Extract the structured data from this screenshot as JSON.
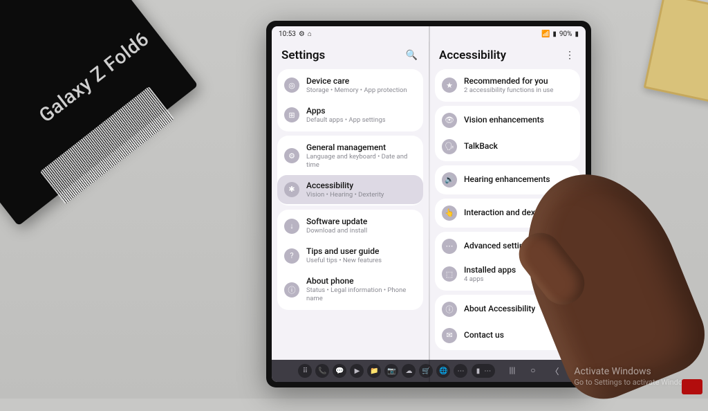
{
  "background": {
    "box_label": "Galaxy Z Fold6",
    "watermark_title": "Activate Windows",
    "watermark_sub": "Go to Settings to activate Windows."
  },
  "status": {
    "time": "10:53",
    "battery": "90%"
  },
  "left": {
    "title": "Settings",
    "groups": [
      {
        "items": [
          {
            "icon": "◎",
            "name": "device-care",
            "title": "Device care",
            "sub": "Storage • Memory • App protection"
          },
          {
            "icon": "⊞",
            "name": "apps",
            "title": "Apps",
            "sub": "Default apps • App settings"
          }
        ]
      },
      {
        "items": [
          {
            "icon": "⚙",
            "name": "general-management",
            "title": "General management",
            "sub": "Language and keyboard • Date and time"
          },
          {
            "icon": "✱",
            "name": "accessibility",
            "title": "Accessibility",
            "sub": "Vision • Hearing • Dexterity",
            "selected": true
          }
        ]
      },
      {
        "items": [
          {
            "icon": "↓",
            "name": "software-update",
            "title": "Software update",
            "sub": "Download and install"
          },
          {
            "icon": "?",
            "name": "tips",
            "title": "Tips and user guide",
            "sub": "Useful tips • New features"
          },
          {
            "icon": "ⓘ",
            "name": "about-phone",
            "title": "About phone",
            "sub": "Status • Legal information • Phone name"
          }
        ]
      }
    ]
  },
  "right": {
    "title": "Accessibility",
    "groups": [
      {
        "items": [
          {
            "icon": "★",
            "name": "recommended",
            "title": "Recommended for you",
            "sub": "2 accessibility functions in use"
          }
        ]
      },
      {
        "items": [
          {
            "icon": "👁",
            "name": "vision",
            "title": "Vision enhancements"
          },
          {
            "icon": "🗣",
            "name": "talkback",
            "title": "TalkBack"
          }
        ]
      },
      {
        "items": [
          {
            "icon": "🔊",
            "name": "hearing",
            "title": "Hearing enhancements"
          }
        ]
      },
      {
        "items": [
          {
            "icon": "👆",
            "name": "interaction",
            "title": "Interaction and dexterity"
          }
        ]
      },
      {
        "items": [
          {
            "icon": "⋯",
            "name": "advanced",
            "title": "Advanced settings"
          },
          {
            "icon": "⬚",
            "name": "installed",
            "title": "Installed apps",
            "sub": "4 apps"
          }
        ]
      },
      {
        "items": [
          {
            "icon": "ⓘ",
            "name": "about-accessibility",
            "title": "About Accessibility"
          },
          {
            "icon": "✉",
            "name": "contact",
            "title": "Contact us"
          }
        ]
      }
    ]
  },
  "taskbar": {
    "icons": [
      "⠿",
      "📞",
      "💬",
      "▶",
      "📁",
      "📷",
      "☁",
      "🛒",
      "🌐",
      "⋯"
    ]
  }
}
